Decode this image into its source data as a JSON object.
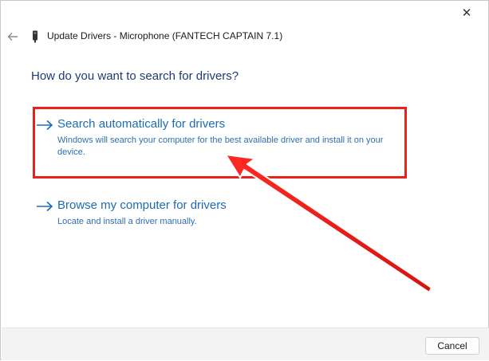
{
  "window": {
    "title": "Update Drivers - Microphone (FANTECH CAPTAIN 7.1)",
    "close_icon": "close-icon",
    "back_icon": "back-arrow-icon",
    "device_icon": "device-icon"
  },
  "main": {
    "heading": "How do you want to search for drivers?",
    "options": [
      {
        "title": "Search automatically for drivers",
        "description": "Windows will search your computer for the best available driver and install it on your device.",
        "icon": "arrow-right-icon"
      },
      {
        "title": "Browse my computer for drivers",
        "description": "Locate and install a driver manually.",
        "icon": "arrow-right-icon"
      }
    ]
  },
  "footer": {
    "cancel_label": "Cancel"
  },
  "colors": {
    "heading": "#1f3b73",
    "link": "#1e6bb0",
    "annotation": "#e8211d",
    "footer_bg": "#f3f3f3"
  }
}
